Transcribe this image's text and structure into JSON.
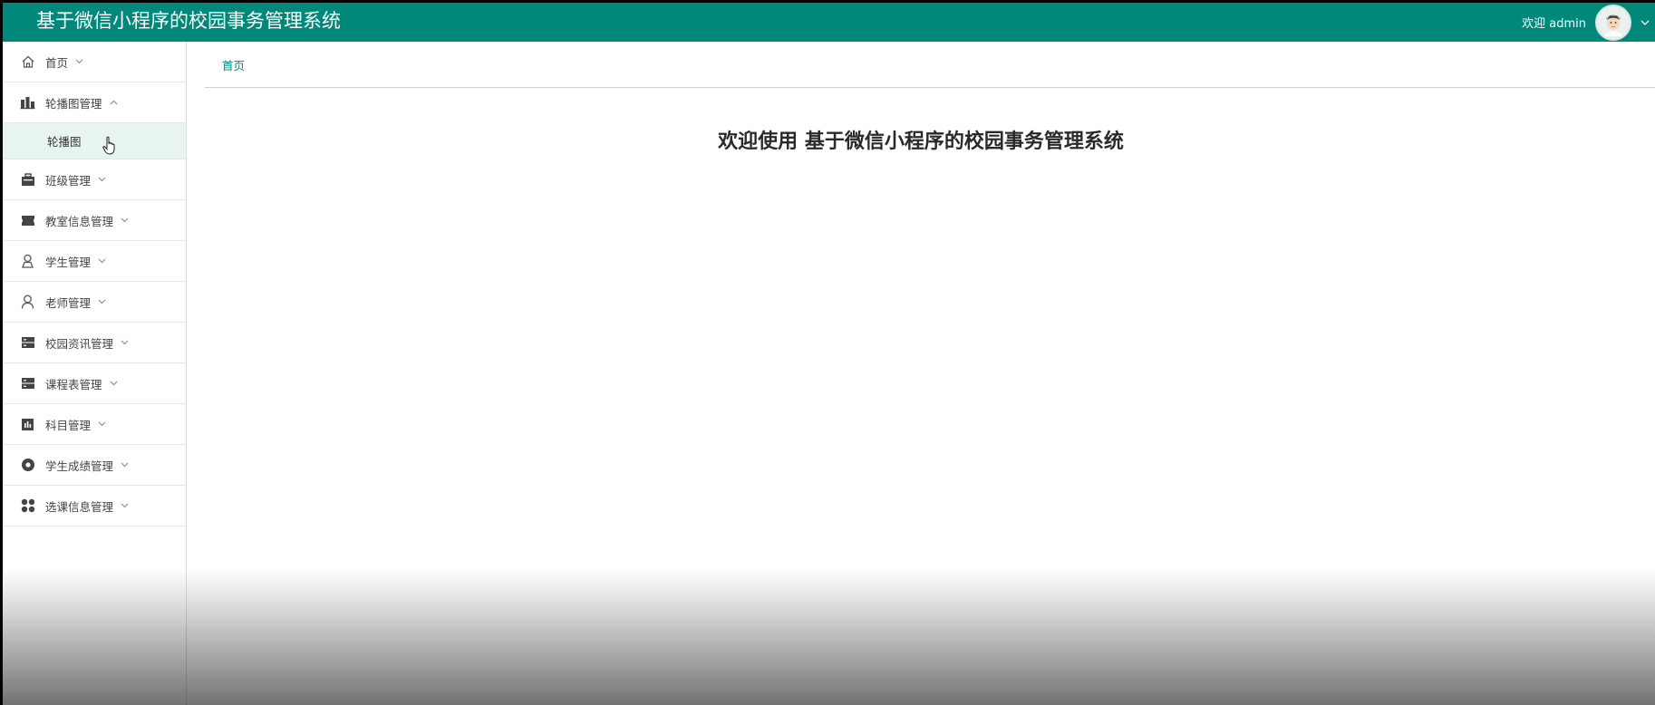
{
  "header": {
    "title": "基于微信小程序的校园事务管理系统",
    "welcome": "欢迎 admin"
  },
  "sidebar": {
    "items": [
      {
        "label": "首页",
        "icon": "home-icon",
        "expanded": false
      },
      {
        "label": "轮播图管理",
        "icon": "carousel-icon",
        "expanded": true,
        "children": [
          {
            "label": "轮播图"
          }
        ]
      },
      {
        "label": "班级管理",
        "icon": "briefcase-icon",
        "expanded": false
      },
      {
        "label": "教室信息管理",
        "icon": "ticket-icon",
        "expanded": false
      },
      {
        "label": "学生管理",
        "icon": "student-icon",
        "expanded": false
      },
      {
        "label": "老师管理",
        "icon": "user-icon",
        "expanded": false
      },
      {
        "label": "校园资讯管理",
        "icon": "server-icon",
        "expanded": false
      },
      {
        "label": "课程表管理",
        "icon": "server-icon",
        "expanded": false
      },
      {
        "label": "科目管理",
        "icon": "chart-box-icon",
        "expanded": false
      },
      {
        "label": "学生成绩管理",
        "icon": "record-icon",
        "expanded": false
      },
      {
        "label": "选课信息管理",
        "icon": "grid-icon",
        "expanded": false
      }
    ]
  },
  "breadcrumb": {
    "home": "首页"
  },
  "main": {
    "heading": "欢迎使用 基于微信小程序的校园事务管理系统"
  },
  "colors": {
    "primary": "#00897b",
    "submenu_active_bg": "#e8f4f2"
  }
}
